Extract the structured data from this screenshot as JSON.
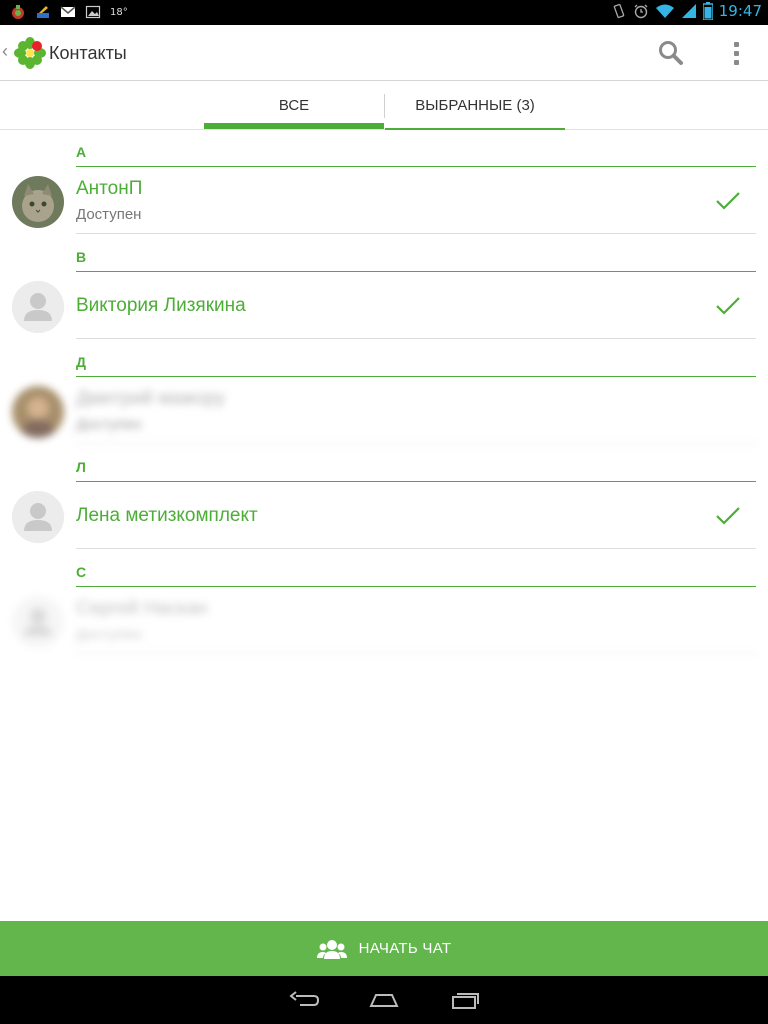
{
  "status_bar": {
    "temperature": "18°",
    "time": "19:47",
    "icons": [
      "app-notification-icon",
      "paint-icon",
      "gmail-icon",
      "image-icon",
      "vibrate-icon",
      "alarm-icon",
      "wifi-icon",
      "signal-icon",
      "battery-icon"
    ]
  },
  "action_bar": {
    "title": "Контакты",
    "back_glyph": "‹",
    "icons": [
      "icq-flower-logo",
      "search-icon",
      "more-vert-icon"
    ]
  },
  "tabs": {
    "all": "ВСЕ",
    "favorites": "ВЫБРАННЫЕ (3)",
    "active": "all"
  },
  "sections": [
    {
      "letter": "А",
      "contacts": [
        {
          "name": "АнтонП",
          "status": "Доступен",
          "selected": true,
          "avatar": "cat-photo"
        }
      ]
    },
    {
      "letter": "В",
      "contacts": [
        {
          "name": "Виктория Лизякина",
          "status": "",
          "selected": true,
          "avatar": "default-person"
        }
      ]
    },
    {
      "letter": "Д",
      "contacts": [
        {
          "name": "Дмитрий мажору",
          "status": "Доступен",
          "selected": false,
          "blurred": true,
          "avatar": "person-photo"
        }
      ]
    },
    {
      "letter": "Л",
      "contacts": [
        {
          "name": "Лена метизкомплект",
          "status": "",
          "selected": true,
          "avatar": "default-person"
        }
      ]
    },
    {
      "letter": "С",
      "contacts": [
        {
          "name": "Сергей Наскан",
          "status": "Доступен",
          "selected": false,
          "blurred": true,
          "avatar": "default-person"
        }
      ]
    }
  ],
  "bottom_button": {
    "label": "НАЧАТЬ ЧАТ",
    "icon": "group-chat-icon"
  },
  "nav_bar": {
    "icons": [
      "back-nav-icon",
      "home-nav-icon",
      "recent-apps-icon"
    ]
  },
  "colors": {
    "accent": "#4cae37",
    "button": "#62b64c",
    "status_time": "#34b5e5"
  }
}
